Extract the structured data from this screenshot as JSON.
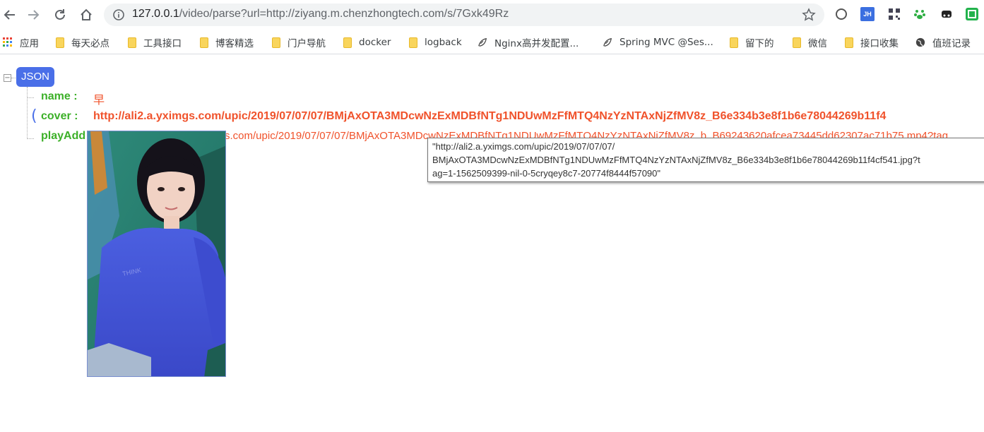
{
  "toolbar": {
    "url_host": "127.0.0.1",
    "url_rest": "/video/parse?url=http://ziyang.m.chenzhongtech.com/s/7Gxk49Rz"
  },
  "bookmarks": [
    {
      "label": "应用",
      "icon": "apps-grid-icon"
    },
    {
      "label": "每天必点",
      "icon": "folder-icon"
    },
    {
      "label": "工具接口",
      "icon": "folder-icon"
    },
    {
      "label": "博客精选",
      "icon": "folder-icon"
    },
    {
      "label": "门户导航",
      "icon": "folder-icon"
    },
    {
      "label": "docker",
      "icon": "folder-icon"
    },
    {
      "label": "logback",
      "icon": "folder-icon"
    },
    {
      "label": "Nginx高并发配置...",
      "icon": "leaf-icon"
    },
    {
      "label": "Spring MVC @Ses...",
      "icon": "leaf-icon"
    },
    {
      "label": "留下的",
      "icon": "folder-icon"
    },
    {
      "label": "微信",
      "icon": "folder-icon"
    },
    {
      "label": "接口收集",
      "icon": "folder-icon"
    },
    {
      "label": "值班记录",
      "icon": "globe-icon"
    }
  ],
  "json_view": {
    "root_label": "JSON",
    "fields": [
      {
        "key": "name :",
        "value": "早"
      },
      {
        "key": "cover :",
        "value": "http://ali2.a.yximgs.com/upic/2019/07/07/07/BMjAxOTA3MDcwNzExMDBfNTg1NDUwMzFfMTQ4NzYzNTAxNjZfMV8z_B6e334b3e8f1b6e78044269b11f4"
      },
      {
        "key": "playAdd",
        "value": "s.com/upic/2019/07/07/07/BMjAxOTA3MDcwNzExMDBfNTg1NDUwMzFfMTQ4NzYzNTAxNjZfMV8z_b_B69243620afcea73445dd62307ac71b75.mp4?tag"
      }
    ]
  },
  "tooltip": {
    "line1": "\"http://ali2.a.yximgs.com/upic/2019/07/07/07/",
    "line2": "BMjAxOTA3MDcwNzExMDBfNTg1NDUwMzFfMTQ4NzYzNTAxNjZfMV8z_B6e334b3e8f1b6e78044269b11f4cf541.jpg?t",
    "line3": "ag=1-1562509399-nil-0-5cryqey8c7-20774f8444f57090\""
  }
}
